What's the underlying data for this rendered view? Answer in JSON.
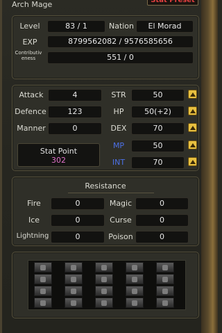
{
  "window": {
    "title": "Arch Mage",
    "preset_button": "Stat Preset"
  },
  "info": {
    "level_label": "Level",
    "level_value": "83 / 1",
    "nation_label": "Nation",
    "nation_value": "El Morad",
    "exp_label": "EXP",
    "exp_value": "8799562082 / 9576585656",
    "contrib_label": "Contributiveness",
    "contrib_value": "551 / 0"
  },
  "stats": {
    "attack_label": "Attack",
    "attack_value": "4",
    "defence_label": "Defence",
    "defence_value": "123",
    "manner_label": "Manner",
    "manner_value": "0",
    "str_label": "STR",
    "str_value": "50",
    "hp_label": "HP",
    "hp_value": "50(+2)",
    "dex_label": "DEX",
    "dex_value": "70",
    "mp_label": "MP",
    "mp_value": "50",
    "int_label": "INT",
    "int_value": "70",
    "stat_point_label": "Stat Point",
    "stat_point_value": "302",
    "colors": {
      "mp_int_label": "#4c70e6",
      "stat_point_value": "#e070c8",
      "up_button": "#e8c040"
    }
  },
  "resistance": {
    "title": "Resistance",
    "fire_label": "Fire",
    "fire_value": "0",
    "ice_label": "Ice",
    "ice_value": "0",
    "lightning_label": "Lightning",
    "lightning_value": "0",
    "magic_label": "Magic",
    "magic_value": "0",
    "curse_label": "Curse",
    "curse_value": "0",
    "poison_label": "Poison",
    "poison_value": "0"
  },
  "slots": {
    "rows": 4,
    "cols": 5,
    "icon": "gear-slot-icon"
  }
}
